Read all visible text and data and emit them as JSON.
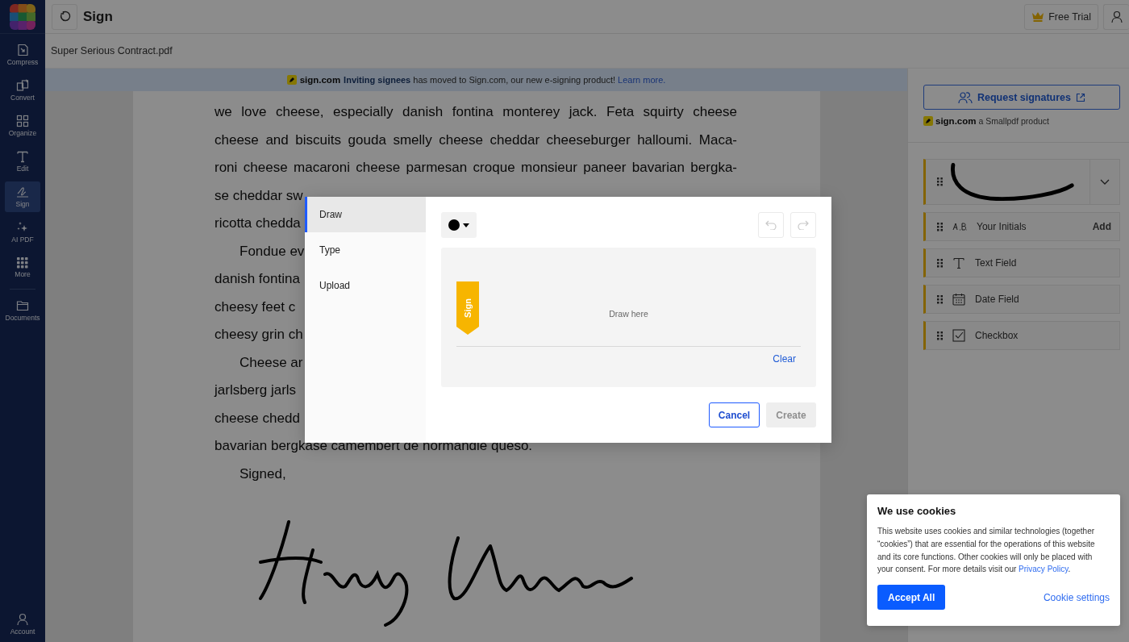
{
  "sidebar": {
    "items": [
      {
        "kind": "compress",
        "label": "Compress",
        "selected": false
      },
      {
        "kind": "convert",
        "label": "Convert",
        "selected": false
      },
      {
        "kind": "organize",
        "label": "Organize",
        "selected": false
      },
      {
        "kind": "edit",
        "label": "Edit",
        "selected": false
      },
      {
        "kind": "sign",
        "label": "Sign",
        "selected": true
      },
      {
        "kind": "ai",
        "label": "AI PDF",
        "selected": false
      },
      {
        "kind": "more",
        "label": "More",
        "selected": false
      },
      {
        "kind": "documents",
        "label": "Documents",
        "selected": false
      }
    ],
    "account": "Account"
  },
  "header": {
    "title": "Sign",
    "free_trial": "Free Trial"
  },
  "file": {
    "name": "Super Serious Contract.pdf"
  },
  "notice": {
    "brand": "sign.com",
    "text": "**Inviting signees** has moved to Sign.com, our new e-signing product!",
    "link": "Learn more."
  },
  "document": {
    "lines": [
      {
        "kind": "justified",
        "indented": false,
        "text": "we love cheese, especially danish fontina monterey jack. Feta squirty cheese"
      },
      {
        "kind": "justified",
        "indented": false,
        "text": "cheese and biscuits gouda smelly cheese cheddar cheeseburger halloumi. Maca-"
      },
      {
        "kind": "justified",
        "indented": false,
        "text": "roni cheese macaroni cheese parmesan croque monsieur paneer bavarian bergka-"
      },
      {
        "kind": "plain",
        "indented": false,
        "text": "se cheddar sw"
      },
      {
        "kind": "plain",
        "indented": false,
        "text": "ricotta chedda"
      },
      {
        "kind": "plain",
        "indented": true,
        "text": "Fondue ev"
      },
      {
        "kind": "plain",
        "indented": false,
        "text": "danish fontina"
      },
      {
        "kind": "plain",
        "indented": false,
        "text": "cheesy feet c"
      },
      {
        "kind": "plain",
        "indented": false,
        "text": "cheesy grin ch"
      },
      {
        "kind": "plain",
        "indented": true,
        "text": "Cheese ar"
      },
      {
        "kind": "plain",
        "indented": false,
        "text": "jarlsberg jarls"
      },
      {
        "kind": "plain",
        "indented": false,
        "text": "cheese chedd"
      },
      {
        "kind": "plain",
        "indented": false,
        "text": "bavarian bergkase camembert de normandie queso."
      },
      {
        "kind": "plain",
        "indented": true,
        "text": "Signed,"
      }
    ]
  },
  "signature_dialog": {
    "tabs": [
      {
        "label": "Draw",
        "selected": true
      },
      {
        "label": "Type",
        "selected": false
      },
      {
        "label": "Upload",
        "selected": false
      }
    ],
    "undo_disabled": true,
    "redo_disabled": true,
    "flag": "Sign",
    "placeholder": "Draw here",
    "clear": "Clear",
    "cancel": "Cancel",
    "create": "Create",
    "create_disabled": true
  },
  "right_panel": {
    "request_button": "Request signatures",
    "brand": "sign.com",
    "brand_tagline": "a Smallpdf product",
    "fields": [
      {
        "kind": "signature"
      },
      {
        "kind": "initials",
        "label": "Your Initials",
        "action": "Add"
      },
      {
        "kind": "text",
        "label": "Text Field"
      },
      {
        "kind": "date",
        "label": "Date Field"
      },
      {
        "kind": "checkbox",
        "label": "Checkbox"
      }
    ]
  },
  "cookie_banner": {
    "title": "We use cookies",
    "text": "This website uses cookies and similar technologies (together “cookies”) that are essential for the operations of this website and its core functions. Other cookies will only be placed with your consent. For more details visit our",
    "link": "Privacy Policy",
    "after": ".",
    "accept": "Accept All",
    "settings": "Cookie settings"
  }
}
